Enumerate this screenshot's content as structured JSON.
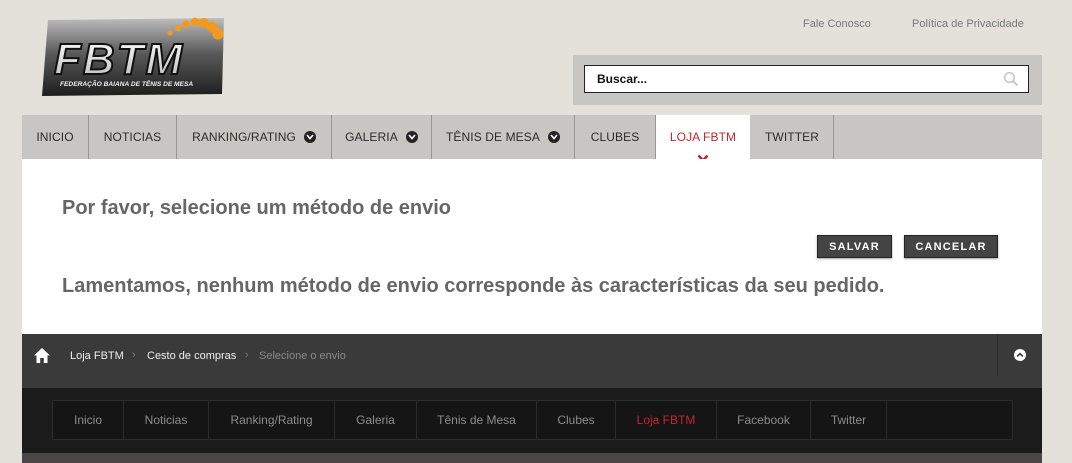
{
  "logo": {
    "text": "FBTM",
    "tagline": "FEDERAÇÃO BAIANA DE TÊNIS DE MESA",
    "accent": "#f39a1e"
  },
  "top_links": {
    "contact": "Fale Conosco",
    "privacy": "Política de Privacidade"
  },
  "search": {
    "placeholder": "Buscar..."
  },
  "nav": {
    "items": [
      {
        "label": "INICIO"
      },
      {
        "label": "NOTICIAS"
      },
      {
        "label": "RANKING/RATING"
      },
      {
        "label": "GALERIA"
      },
      {
        "label": "TÊNIS DE MESA"
      },
      {
        "label": "CLUBES"
      },
      {
        "label": "LOJA FBTM"
      },
      {
        "label": "TWITTER"
      }
    ]
  },
  "content": {
    "heading": "Por favor, selecione um método de envio",
    "message": "Lamentamos, nenhum método de envio corresponde às características da seu pedido.",
    "save_label": "SALVAR",
    "cancel_label": "CANCELAR"
  },
  "breadcrumb": {
    "items": [
      {
        "label": "Loja FBTM"
      },
      {
        "label": "Cesto de compras"
      },
      {
        "label": "Selecione o envio"
      }
    ]
  },
  "footer_nav": {
    "items": [
      {
        "label": "Inicio"
      },
      {
        "label": "Noticias"
      },
      {
        "label": "Ranking/Rating"
      },
      {
        "label": "Galeria"
      },
      {
        "label": "Tênis de Mesa"
      },
      {
        "label": "Clubes"
      },
      {
        "label": "Loja FBTM"
      },
      {
        "label": "Facebook"
      },
      {
        "label": "Twitter"
      }
    ]
  },
  "colors": {
    "active": "#c1272d",
    "page_bg": "#e4e1da",
    "nav_bg": "#c7c6c3",
    "footer_bg": "#1b1b1b"
  }
}
